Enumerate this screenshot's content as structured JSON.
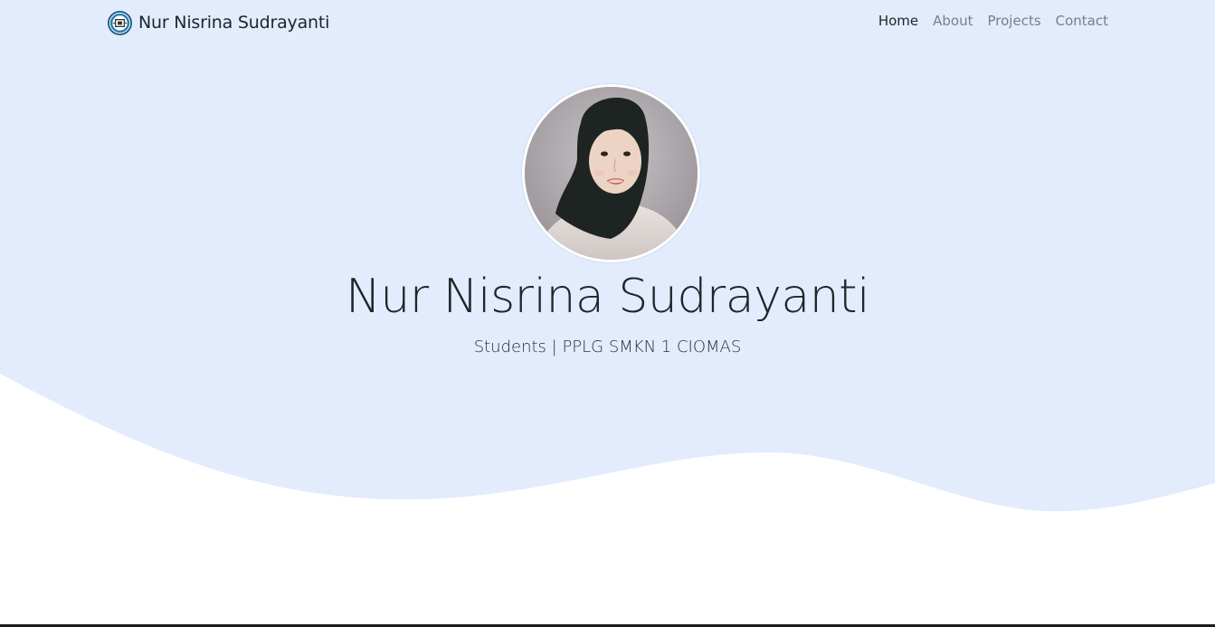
{
  "brand": {
    "name": "Nur Nisrina Sudrayanti",
    "logo_icon": "school-emblem-icon"
  },
  "nav": {
    "items": [
      {
        "label": "Home",
        "active": true
      },
      {
        "label": "About",
        "active": false
      },
      {
        "label": "Projects",
        "active": false
      },
      {
        "label": "Contact",
        "active": false
      }
    ]
  },
  "hero": {
    "name": "Nur Nisrina Sudrayanti",
    "subtitle": "Students | PPLG SMKN 1 CIOMAS",
    "avatar_icon": "profile-photo",
    "background_color": "#e2ecfd",
    "wave_color": "#e2ecfd"
  },
  "colors": {
    "text_primary": "#212529",
    "nav_inactive": "#7b7f84",
    "page_background": "#ffffff"
  }
}
